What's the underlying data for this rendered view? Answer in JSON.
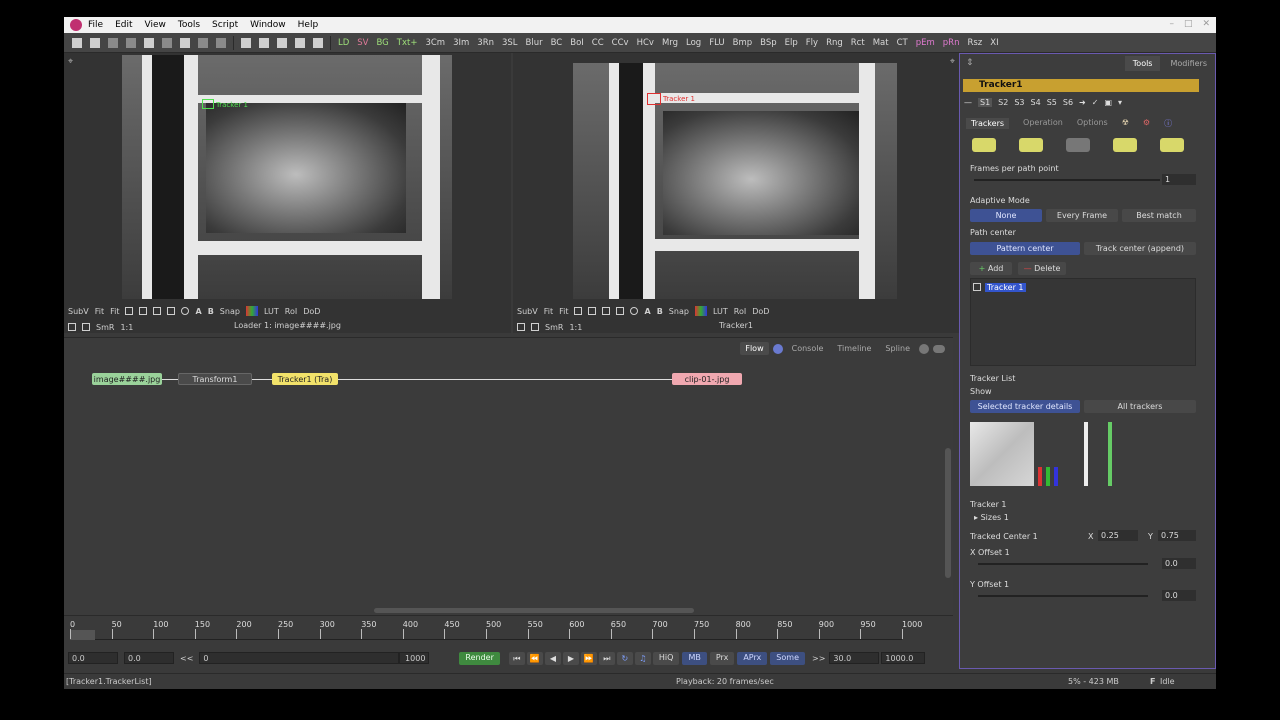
{
  "menu": {
    "items": [
      "File",
      "Edit",
      "View",
      "Tools",
      "Script",
      "Window",
      "Help"
    ]
  },
  "toolbar": {
    "labels": [
      "LD",
      "SV",
      "BG",
      "Txt+",
      "3Cm",
      "3Im",
      "3Rn",
      "3SL",
      "Blur",
      "BC",
      "BoI",
      "CC",
      "CCv",
      "HCv",
      "Mrg",
      "Log",
      "FLU",
      "Bmp",
      "BSp",
      "Elp",
      "Fly",
      "Rng",
      "Rct",
      "Mat",
      "CT",
      "pEm",
      "pRn",
      "Rsz",
      "XI"
    ]
  },
  "viewer1": {
    "caption": "Loader 1: image####.jpg",
    "tracker_label": "Tracker 1",
    "bar": [
      "SubV",
      "Fit",
      "Fit",
      "SmR",
      "1:1",
      "Snap",
      "LUT",
      "RoI",
      "DoD"
    ]
  },
  "viewer2": {
    "caption": "Tracker1",
    "tracker_label": "Tracker 1",
    "bar": [
      "SubV",
      "Fit",
      "Fit",
      "SmR",
      "1:1",
      "Snap",
      "LUT",
      "RoI",
      "DoD"
    ]
  },
  "flow": {
    "tabs": [
      "Flow",
      "Console",
      "Timeline",
      "Spline"
    ],
    "nodes": {
      "loader": "image####.jpg",
      "transform": "Transform1",
      "tracker": "Tracker1 (Tra)",
      "saver": "clip-01-.jpg"
    }
  },
  "timeline": {
    "ticks": [
      "0",
      "50",
      "100",
      "150",
      "200",
      "250",
      "300",
      "350",
      "400",
      "450",
      "500",
      "550",
      "600",
      "650",
      "700",
      "750",
      "800",
      "850",
      "900",
      "950",
      "1000"
    ],
    "start": "0.0",
    "end": "0.0",
    "range_start": "0",
    "range_end": "1000",
    "render": "Render",
    "hiq": "HiQ",
    "mb": "MB",
    "prx": "Prx",
    "aprx": "APrx",
    "some": "Some",
    "fps": "30.0",
    "current": "1000.0",
    "current_time": "0.0",
    "chev_l": "<<",
    "chev_r": ">>"
  },
  "status": {
    "left": "[Tracker1.TrackerList]",
    "mid": "Playback: 20 frames/sec",
    "mem": "5% - 423 MB",
    "state": "Idle"
  },
  "panel": {
    "tabs": [
      "Tools",
      "Modifiers"
    ],
    "title": "Tracker1",
    "slots": [
      "S1",
      "S2",
      "S3",
      "S4",
      "S5",
      "S6"
    ],
    "subtabs": [
      "Trackers",
      "Operation",
      "Options"
    ],
    "frames_per_path": "Frames per path point",
    "frames_value": "1",
    "adaptive_mode": "Adaptive Mode",
    "adaptive_opts": [
      "None",
      "Every Frame",
      "Best match"
    ],
    "path_center": "Path center",
    "path_opts": [
      "Pattern center",
      "Track center (append)"
    ],
    "add": "Add",
    "delete": "Delete",
    "tracker_item": "Tracker 1",
    "tracker_list": "Tracker List",
    "show": "Show",
    "show_opts": [
      "Selected tracker details",
      "All trackers"
    ],
    "tracker1": "Tracker 1",
    "sizes": "Sizes 1",
    "tracked_center": "Tracked Center 1",
    "x_label": "X",
    "x_val": "0.25",
    "y_label": "Y",
    "y_val": "0.75",
    "x_offset": "X Offset 1",
    "x_offset_val": "0.0",
    "y_offset": "Y Offset 1",
    "y_offset_val": "0.0"
  }
}
